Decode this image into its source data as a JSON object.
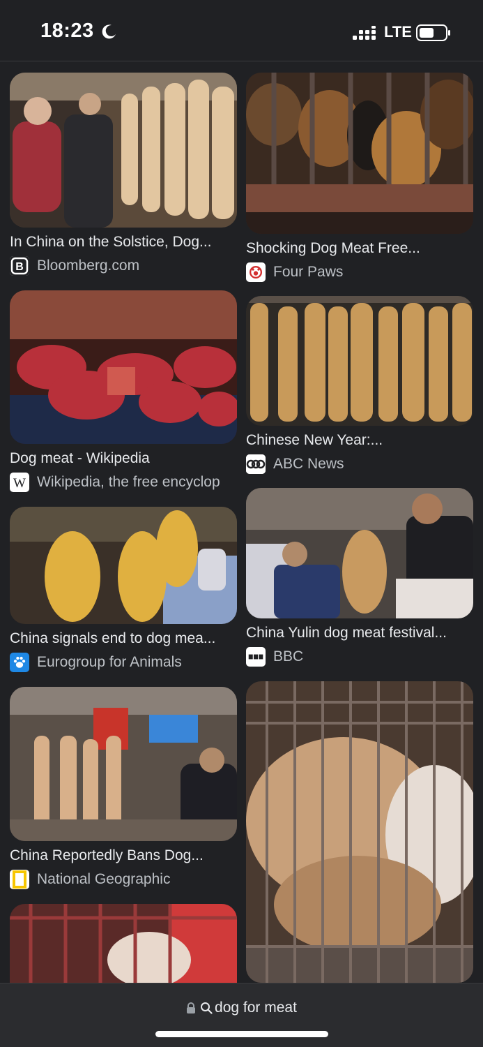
{
  "status_bar": {
    "time": "18:23",
    "network": "LTE",
    "icons": [
      "moon-icon",
      "signal-icon",
      "battery-icon"
    ]
  },
  "results": [
    {
      "title": "In China on the Solstice, Dog...",
      "source": "Bloomberg.com",
      "favicon": "bloomberg-logo-icon"
    },
    {
      "title": "Shocking Dog Meat Free...",
      "source": "Four Paws",
      "favicon": "four-paws-logo-icon"
    },
    {
      "title": "Dog meat - Wikipedia",
      "source": "Wikipedia, the free encyclop",
      "favicon": "wikipedia-logo-icon"
    },
    {
      "title": "Chinese New Year:...",
      "source": "ABC News",
      "favicon": "abc-news-logo-icon"
    },
    {
      "title": "China signals end to dog mea...",
      "source": "Eurogroup for Animals",
      "favicon": "paw-print-icon"
    },
    {
      "title": "China Yulin dog meat festival...",
      "source": "BBC",
      "favicon": "bbc-logo-icon"
    },
    {
      "title": "China Reportedly Bans Dog...",
      "source": "National Geographic",
      "favicon": "natgeo-logo-icon"
    }
  ],
  "address_bar": {
    "query": "dog for meat",
    "icons": [
      "lock-icon",
      "search-icon"
    ]
  },
  "colors": {
    "background": "#202124",
    "text": "#e8eaed",
    "secondary_text": "#bdc1c6"
  }
}
